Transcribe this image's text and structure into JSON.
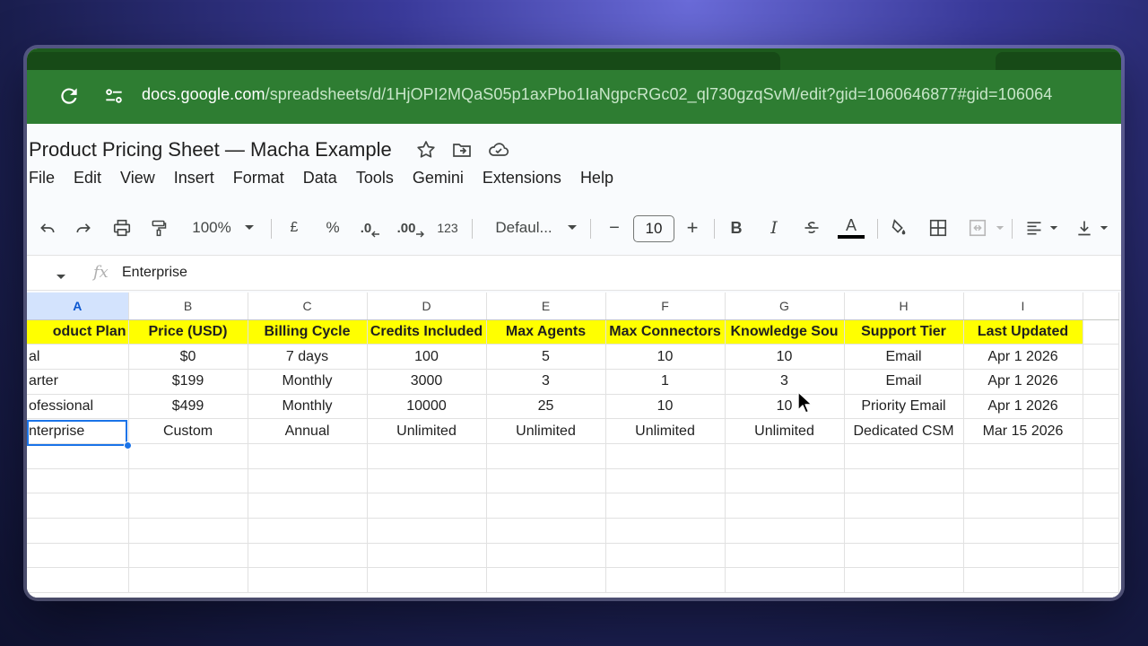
{
  "browser": {
    "url_host": "docs.google.com",
    "url_path": "/spreadsheets/d/1HjOPI2MQaS05p1axPbo1IaNgpcRGc02_ql730gzqSvM/edit?gid=1060646877#gid=106064"
  },
  "doc": {
    "title": "Product Pricing Sheet — Macha Example"
  },
  "menu": [
    "File",
    "Edit",
    "View",
    "Insert",
    "Format",
    "Data",
    "Tools",
    "Gemini",
    "Extensions",
    "Help"
  ],
  "toolbar": {
    "zoom": "100%",
    "currency": "£",
    "percent": "%",
    "decrease_decimal": ".0",
    "increase_decimal": ".00",
    "number_format": "123",
    "font": "Defaul...",
    "font_size": "10",
    "minus": "−",
    "plus": "+",
    "bold": "B",
    "italic": "I",
    "text_color": "A"
  },
  "formula": {
    "fx": "fx",
    "value": "Enterprise"
  },
  "grid": {
    "columns": [
      "A",
      "B",
      "C",
      "D",
      "E",
      "F",
      "G",
      "H",
      "I"
    ],
    "header": [
      "oduct Plan",
      "Price (USD)",
      "Billing Cycle",
      "Credits Included",
      "Max Agents",
      "Max Connectors",
      "Knowledge Sou",
      "Support Tier",
      "Last Updated"
    ],
    "rows": [
      [
        "al",
        "$0",
        "7 days",
        "100",
        "5",
        "10",
        "10",
        "Email",
        "Apr 1 2026"
      ],
      [
        "arter",
        "$199",
        "Monthly",
        "3000",
        "3",
        "1",
        "3",
        "Email",
        "Apr 1 2026"
      ],
      [
        "ofessional",
        "$499",
        "Monthly",
        "10000",
        "25",
        "10",
        "10",
        "Priority Email",
        "Apr 1 2026"
      ],
      [
        "nterprise",
        "Custom",
        "Annual",
        "Unlimited",
        "Unlimited",
        "Unlimited",
        "Unlimited",
        "Dedicated CSM",
        "Mar 15 2026"
      ]
    ],
    "header_color": "#ffff00",
    "selection_color": "#1a73e8"
  }
}
